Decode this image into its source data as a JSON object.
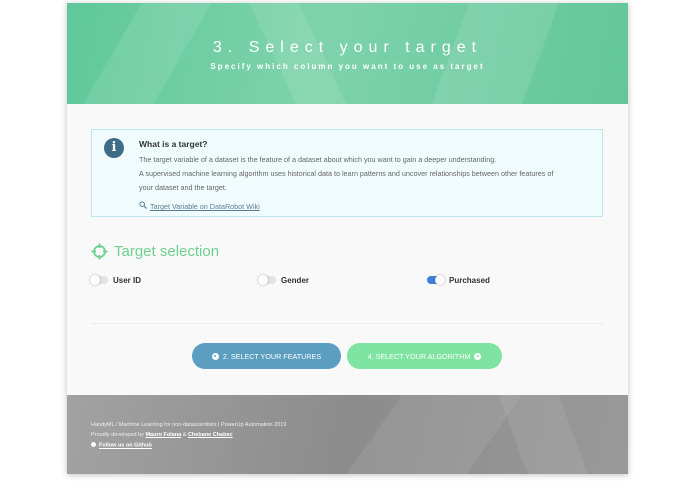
{
  "header": {
    "title": "3. Select your target",
    "subtitle": "Specify which column you want to use as target"
  },
  "info": {
    "icon": "info-icon",
    "title": "What is a target?",
    "lines": [
      "The target variable of a dataset is the feature of a dataset about which you want to gain a deeper understanding.",
      "A supervised machine learning algorithm uses historical data to learn patterns and uncover relationships between other features of",
      "your dataset and the target."
    ],
    "link": "Target Variable on DataRobot Wiki"
  },
  "target_selection": {
    "title": "Target selection",
    "options": [
      {
        "label": "User ID",
        "checked": false
      },
      {
        "label": "Gender",
        "checked": false
      },
      {
        "label": "Purchased",
        "checked": true
      }
    ]
  },
  "navigation": {
    "prev_label": "2. SELECT YOUR FEATURES",
    "next_label": "4. SELECT YOUR ALGORITHM"
  },
  "footer": {
    "line1": "HandyML / Machine Learning for non-datascientists | PowerUp Automation 2019",
    "line2_prefix": "Proudly developed by ",
    "author1": "Mauro Folana",
    "line2_sep": " & ",
    "author2": "Chebane Chabec",
    "github": "Follow us on Github"
  },
  "colors": {
    "accent_green": "#6fd08f",
    "prev_button": "#5b9ec0",
    "next_button": "#7fe3a1",
    "toggle_on": "#3d7fd9"
  }
}
